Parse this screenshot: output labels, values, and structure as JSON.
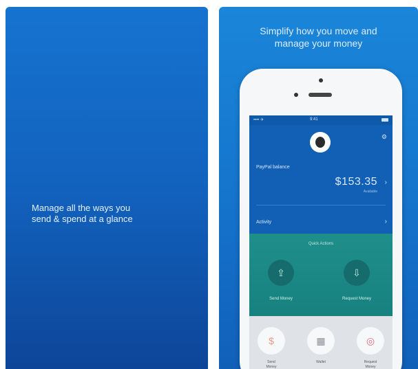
{
  "left_panel": {
    "caption": "Manage all the ways you\nsend & spend at a glance"
  },
  "right_panel": {
    "caption": "Simplify how you move and\nmanage your money"
  },
  "phone": {
    "status_bar": {
      "carrier": "•••• ✈",
      "time": "9:41"
    },
    "balance": {
      "label": "PayPal balance",
      "amount": "$153.35",
      "subtext": "Available"
    },
    "activity_label": "Activity",
    "quick_actions": {
      "label": "Quick Actions",
      "send_label": "Send Money",
      "request_label": "Request Money"
    },
    "tools": [
      {
        "label": "Send\nMoney"
      },
      {
        "label": "Wallet"
      },
      {
        "label": "Request\nMoney"
      }
    ]
  },
  "icons": {
    "gear": "gear-icon",
    "chevron": "chevron-right-icon",
    "send": "send-money-icon",
    "request": "request-money-icon",
    "dollar": "dollar-icon",
    "wallet": "wallet-icon",
    "target": "target-icon"
  },
  "colors": {
    "left_bg": "#1262bd",
    "right_bg": "#1573cc",
    "phone_blue": "#1260b5",
    "phone_green": "#1f8f8a",
    "phone_gray": "#dfe3e7"
  }
}
